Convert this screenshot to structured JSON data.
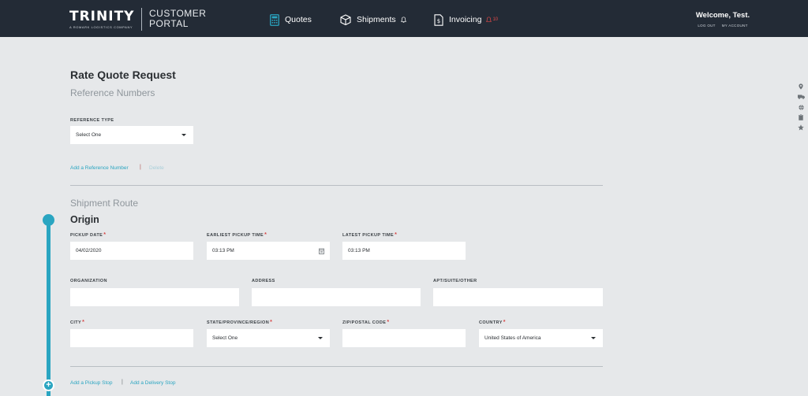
{
  "header": {
    "logo_text": "TRINITY",
    "logo_subtext": "A ROMARK LOGISTICS COMPANY",
    "portal_line1": "CUSTOMER",
    "portal_line2": "PORTAL",
    "nav": [
      {
        "label": "Quotes",
        "icon": "calculator-icon"
      },
      {
        "label": "Shipments",
        "icon": "box-icon"
      },
      {
        "label": "Invoicing",
        "icon": "document-icon",
        "badge": "10"
      }
    ],
    "welcome": "Welcome, Test.",
    "logout_label": "LOG OUT",
    "account_label": "MY ACCOUNT"
  },
  "form": {
    "title": "Rate Quote Request",
    "reference_section": "Reference Numbers",
    "reference_type_label": "REFERENCE TYPE",
    "reference_type_value": "Select One",
    "add_reference": "Add a Reference Number",
    "delete": "Delete",
    "route_section": "Shipment Route",
    "origin_title": "Origin",
    "pickup_date_label": "PICKUP DATE",
    "pickup_date_value": "04/02/2020",
    "earliest_label": "EARLIEST PICKUP TIME",
    "earliest_value": "03:13 PM",
    "latest_label": "LATEST PICKUP TIME",
    "latest_value": "03:13 PM",
    "organization_label": "ORGANIZATION",
    "organization_value": "",
    "address_label": "ADDRESS",
    "address_value": "",
    "apt_label": "APT/SUITE/OTHER",
    "apt_value": "",
    "city_label": "CITY",
    "city_value": "",
    "state_label": "STATE/PROVINCE/REGION",
    "state_value": "Select One",
    "zip_label": "ZIP/POSTAL CODE",
    "zip_value": "",
    "country_label": "COUNTRY",
    "country_value": "United States of America",
    "add_pickup": "Add a Pickup Stop",
    "add_delivery": "Add a Delivery Stop",
    "required_mark": "*",
    "separator": "|"
  },
  "side_icons": [
    "location-pin-icon",
    "truck-icon",
    "globe-icon",
    "clipboard-icon",
    "star-icon"
  ],
  "colors": {
    "header_bg": "#232b36",
    "accent": "#2aa5c1",
    "page_bg": "#e6e8ea",
    "required": "#d64545"
  }
}
